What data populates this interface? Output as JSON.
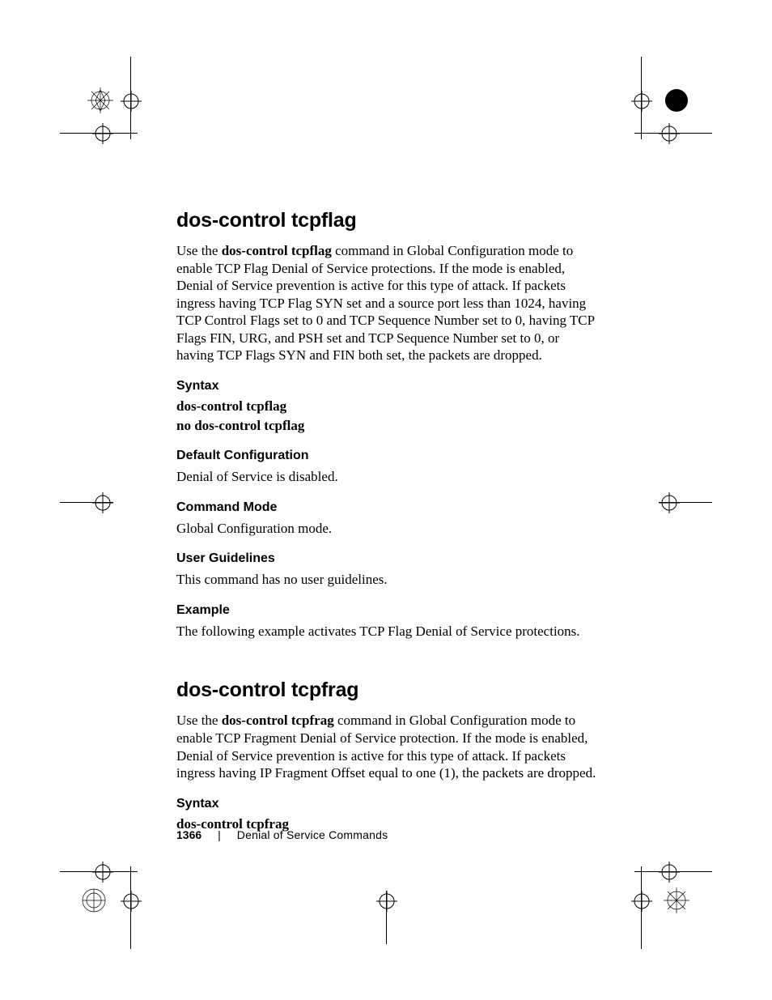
{
  "section1": {
    "title": "dos-control tcpflag",
    "intro_pre": "Use the ",
    "intro_bold": "dos-control tcpflag",
    "intro_post": " command in Global Configuration mode to enable TCP Flag Denial of Service protections. If the mode is enabled, Denial of Service prevention is active for this type of attack. If packets ingress having TCP Flag SYN set and a source port less than 1024, having TCP Control Flags set to 0 and TCP Sequence Number set to 0, having TCP Flags FIN, URG, and PSH set and TCP Sequence Number set to 0, or having TCP Flags SYN and FIN both set, the packets are dropped.",
    "syntax_h": "Syntax",
    "syntax_line1": "dos-control tcpflag",
    "syntax_line2": "no dos-control tcpflag",
    "default_h": "Default Configuration",
    "default_body": "Denial of Service is disabled.",
    "mode_h": "Command Mode",
    "mode_body": "Global Configuration mode.",
    "guide_h": "User Guidelines",
    "guide_body": "This command has no user guidelines.",
    "example_h": "Example",
    "example_body": "The following example activates TCP Flag Denial of Service protections."
  },
  "section2": {
    "title": "dos-control tcpfrag",
    "intro_pre": "Use the ",
    "intro_bold": "dos-control tcpfrag",
    "intro_post": " command in Global Configuration mode to enable TCP Fragment Denial of Service protection. If the mode is enabled, Denial of Service prevention is active for this type of attack. If packets ingress having IP Fragment Offset equal to one (1), the packets are dropped.",
    "syntax_h": "Syntax",
    "syntax_line1": "dos-control tcpfrag"
  },
  "footer": {
    "page": "1366",
    "sep": "|",
    "title": "Denial of Service Commands"
  }
}
